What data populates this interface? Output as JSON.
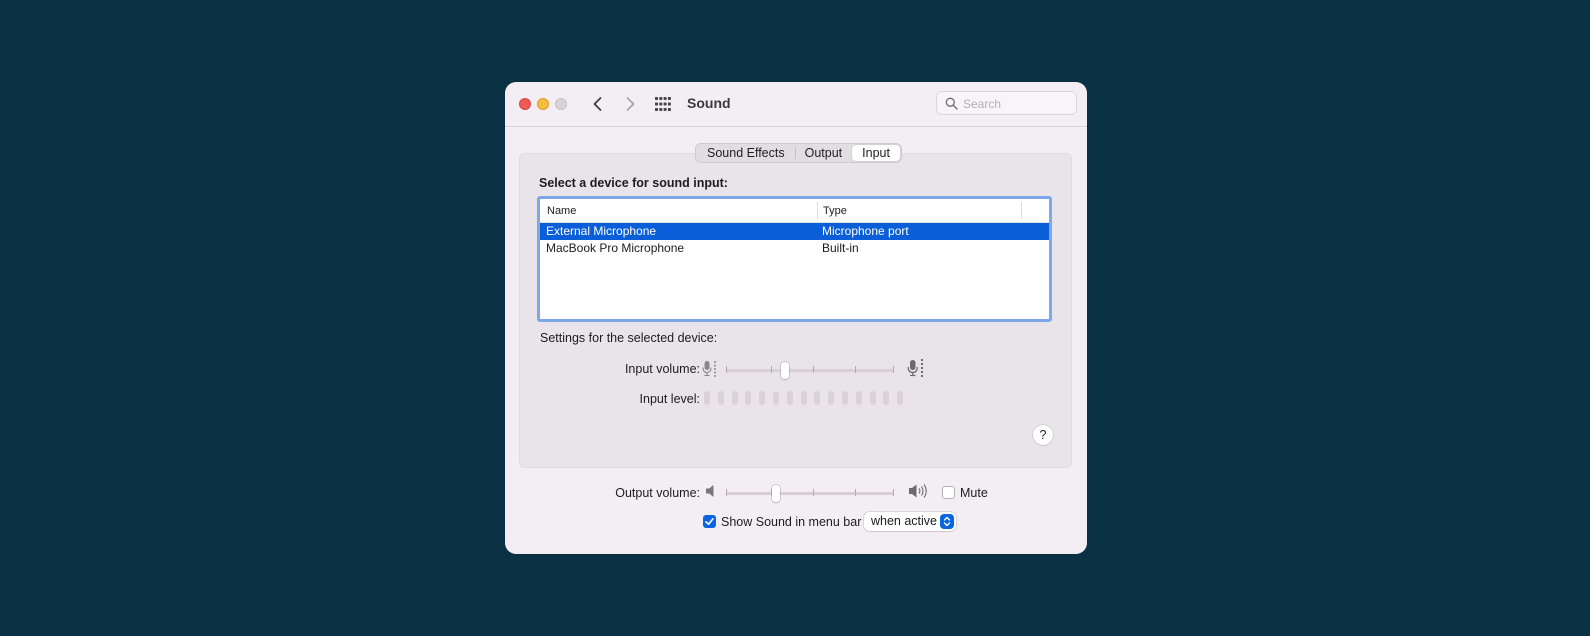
{
  "window": {
    "title": "Sound",
    "search": {
      "placeholder": "Search"
    }
  },
  "tabs": [
    {
      "label": "Sound Effects",
      "selected": false
    },
    {
      "label": "Output",
      "selected": false
    },
    {
      "label": "Input",
      "selected": true
    }
  ],
  "input": {
    "heading": "Select a device for sound input:",
    "columns": {
      "name": "Name",
      "type": "Type"
    },
    "devices": [
      {
        "name": "External Microphone",
        "type": "Microphone port",
        "selected": true
      },
      {
        "name": "MacBook Pro Microphone",
        "type": "Built-in",
        "selected": false
      }
    ],
    "settings_label": "Settings for the selected device:",
    "volume_label": "Input volume:",
    "volume_fraction": 0.35,
    "level_label": "Input level:",
    "level_segments": 15,
    "level_active": 0
  },
  "output": {
    "volume_label": "Output volume:",
    "volume_fraction": 0.3,
    "mute_label": "Mute",
    "muted": false
  },
  "menubar": {
    "show_label": "Show Sound in menu bar",
    "checked": true,
    "popup_value": "when active"
  },
  "help_label": "?",
  "icons": {
    "close": "close-button",
    "minimize": "minimize-button",
    "zoom": "zoom-button",
    "back": "chevron-left-icon",
    "forward": "chevron-right-icon",
    "grid": "grid-icon",
    "search": "magnifier-icon",
    "mic_low": "microphone-low-icon",
    "mic_high": "microphone-high-icon",
    "speaker_low": "speaker-low-icon",
    "speaker_high": "speaker-high-icon"
  },
  "colors": {
    "desktop": "#0b3244",
    "accent": "#0a5fd8",
    "focus_ring": "#7fa6e8"
  }
}
